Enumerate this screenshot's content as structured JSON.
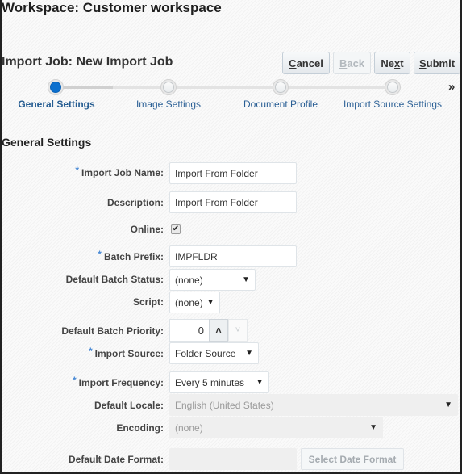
{
  "workspace_title": "Workspace: Customer workspace",
  "job_title": "Import Job: New Import Job",
  "toolbar": {
    "cancel": {
      "pre": "",
      "accel": "C",
      "post": "ancel",
      "enabled": true
    },
    "back": {
      "pre": "",
      "accel": "B",
      "post": "ack",
      "enabled": false
    },
    "next": {
      "pre": "Ne",
      "accel": "x",
      "post": "t",
      "enabled": true
    },
    "submit": {
      "pre": "",
      "accel": "S",
      "post": "ubmit",
      "enabled": true
    }
  },
  "train": {
    "stops": [
      {
        "label": "General Settings",
        "active": true
      },
      {
        "label": "Image Settings",
        "active": false
      },
      {
        "label": "Document Profile",
        "active": false
      },
      {
        "label": "Import Source Settings",
        "active": false
      }
    ],
    "more_icon": "»"
  },
  "section_title": "General Settings",
  "form": {
    "import_job_name": {
      "label": "Import Job Name:",
      "required": true,
      "value": "Import From Folder"
    },
    "description": {
      "label": "Description:",
      "value": "Import From Folder"
    },
    "online": {
      "label": "Online:",
      "checked": true,
      "check_glyph": "✔"
    },
    "batch_prefix": {
      "label": "Batch Prefix:",
      "required": true,
      "value": "IMPFLDR"
    },
    "default_batch_status": {
      "label": "Default Batch Status:",
      "value": "(none)"
    },
    "script": {
      "label": "Script:",
      "value": "(none)"
    },
    "default_batch_priority": {
      "label": "Default Batch Priority:",
      "value": "0",
      "up_icon": "˄",
      "down_icon": "˅"
    },
    "import_source": {
      "label": "Import Source:",
      "required": true,
      "value": "Folder Source"
    },
    "import_frequency": {
      "label": "Import Frequency:",
      "required": true,
      "value": "Every 5 minutes"
    },
    "default_locale": {
      "label": "Default Locale:",
      "value": "English (United States)",
      "disabled": true
    },
    "encoding": {
      "label": "Encoding:",
      "value": "(none)",
      "disabled": true
    },
    "default_date_format": {
      "label": "Default Date Format:",
      "value": "",
      "button": "Select Date Format"
    }
  },
  "required_marker": "*",
  "dropdown_arrow": "▼"
}
